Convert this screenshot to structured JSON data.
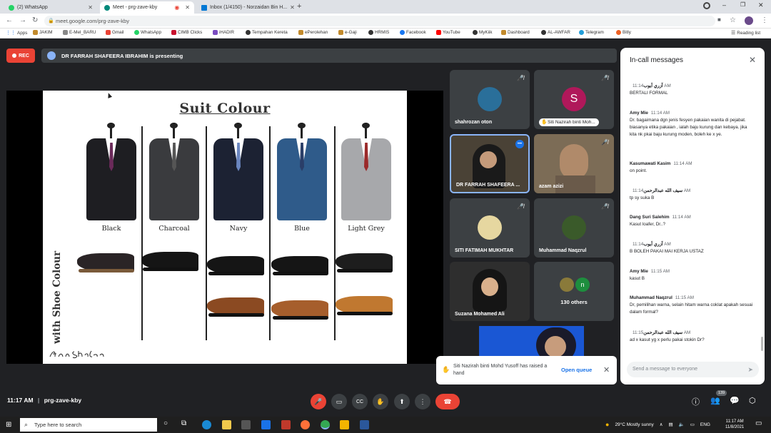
{
  "tabs": [
    {
      "label": "(2) WhatsApp",
      "color": "#25d366"
    },
    {
      "label": "Meet - prg-zave-kby",
      "color": "#00897b"
    },
    {
      "label": "Inbox (1/4150) - Norzaidan Bin H...",
      "color": "#0078d4"
    }
  ],
  "address": {
    "url": "meet.google.com/prg-zave-kby"
  },
  "bookmarks": [
    "Apps",
    "JAKIM",
    "E-Mel_BARU",
    "Gmail",
    "WhatsApp",
    "CIMB Clicks",
    "iHADIR",
    "Tempahan Kereta",
    "ePerolehan",
    "e-Gaji",
    "HRMIS",
    "Facebook",
    "YouTube",
    "MyKiik",
    "Dashboard",
    "AL-AWFAR",
    "Telegram",
    "Bitly"
  ],
  "reading_list": "Reading list",
  "rec_label": "REC",
  "presenting_text": "DR FARRAH SHAFEERA IBRAHIM is presenting",
  "slide": {
    "title": "Suit Colour",
    "vertical_label": "with Shoe Colour",
    "signature": "Dr. Ann Shafeera",
    "suits": [
      {
        "label": "Black",
        "jacket": "#1e1e22",
        "tie": "#6b2a5a"
      },
      {
        "label": "Charcoal",
        "jacket": "#3a3b3e",
        "tie": "#444"
      },
      {
        "label": "Navy",
        "jacket": "#1c2233",
        "tie": "#3b4a7a"
      },
      {
        "label": "Blue",
        "jacket": "#2f5b8a",
        "tie": "#2a3e68"
      },
      {
        "label": "Light Grey",
        "jacket": "#a7a8ab",
        "tie": "#9a2a2a"
      }
    ],
    "shoes_row1": [
      "#2a2426",
      "#151515",
      "#151515",
      "#151515",
      "#1d1d1d"
    ],
    "shoes_row2": [
      "#8b4a22",
      "#a65e2c",
      "#c07830"
    ]
  },
  "participants": [
    {
      "name": "shahrozan oton",
      "avatar_color": "#2a6f9a"
    },
    {
      "name": "Siti Nazirah binti Moh...",
      "avatar_color": "#b0185a",
      "initial": "S"
    },
    {
      "name": "DR FARRAH SHAFEERA ...",
      "avatar_color": "#5a5040"
    },
    {
      "name": "azam azizi",
      "avatar_color": "#8a7a62"
    },
    {
      "name": "SITI FATIMAH MUKHTAR",
      "avatar_color": "#e6d7a0"
    },
    {
      "name": "Muhammad Naqzrul",
      "avatar_color": "#3a5a2a"
    },
    {
      "name": "Suzana Mohamed Ali",
      "avatar_color": "#2a2a2a"
    },
    {
      "name": "130 others",
      "initial": "n",
      "avatar_color": "#1e8e3e"
    }
  ],
  "raise_hand": {
    "text": "Siti Nazirah binti Mohd Yusoff has raised a hand",
    "action": "Open queue"
  },
  "chat": {
    "title": "In-call messages",
    "messages": [
      {
        "sender": "آزري أيوب",
        "time": "11:14 AM",
        "text": "BERTALI FORMAL"
      },
      {
        "sender": "Amy Mie",
        "time": "11:14 AM",
        "text": "Dr. bagaimana dgn jenis fesyen pakaian wanita di pejabat. biasanya etika pakaian , ialah baju kurung dan kebaya. jika kita nk pkai baju kurung moden, boleh ke x ye."
      },
      {
        "sender": "Kasumawati Kasim",
        "time": "11:14 AM",
        "text": "on point."
      },
      {
        "sender": "سيف الله عبدالرحمن",
        "time": "11:14 AM",
        "text": "tp sy suka B"
      },
      {
        "sender": "Dang Suri Salehim",
        "time": "11:14 AM",
        "text": "Kasut loafer, Dr..?"
      },
      {
        "sender": "آزري أيوب",
        "time": "11:14 AM",
        "text": "B BOLEH PAKAI MAI KERJA USTAZ"
      },
      {
        "sender": "Amy Mie",
        "time": "11:15 AM",
        "text": "kasut B"
      },
      {
        "sender": "Muhammad Naqzrul",
        "time": "11:15 AM",
        "text": "Dr, pemilihan warna, selain hitam warna coklat apakah sesuai dalam formal?"
      },
      {
        "sender": "سيف الله عبدالرحمن",
        "time": "11:15 AM",
        "text": "ad x kasut yg x perlu pakai stokin Dr?"
      }
    ],
    "input_placeholder": "Send a message to everyone"
  },
  "meeting": {
    "time": "11:17 AM",
    "code": "prg-zave-kby",
    "people_badge": "139"
  },
  "taskbar": {
    "search_placeholder": "Type here to search",
    "weather": "29°C  Mostly sunny",
    "lang": "ENG",
    "time": "11:17 AM",
    "date": "11/8/2021"
  }
}
